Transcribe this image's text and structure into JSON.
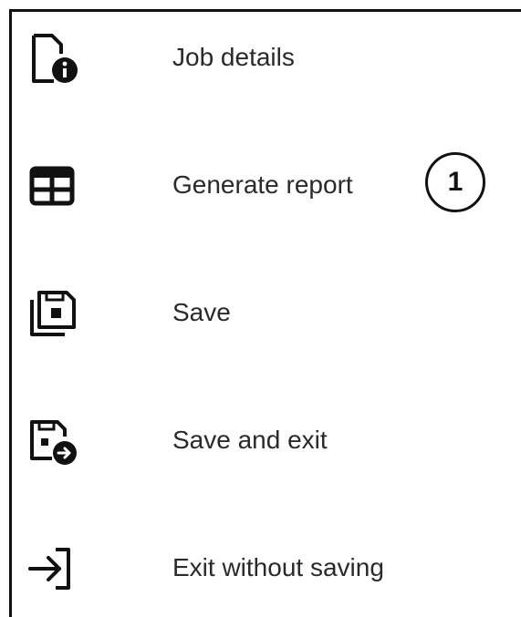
{
  "menu": {
    "items": [
      {
        "label": "Job details",
        "icon": "file-info-icon"
      },
      {
        "label": "Generate report",
        "icon": "table-icon"
      },
      {
        "label": "Save",
        "icon": "save-copy-icon"
      },
      {
        "label": "Save and exit",
        "icon": "save-exit-icon"
      },
      {
        "label": "Exit without saving",
        "icon": "exit-icon"
      }
    ]
  },
  "callout": {
    "number": "1"
  }
}
